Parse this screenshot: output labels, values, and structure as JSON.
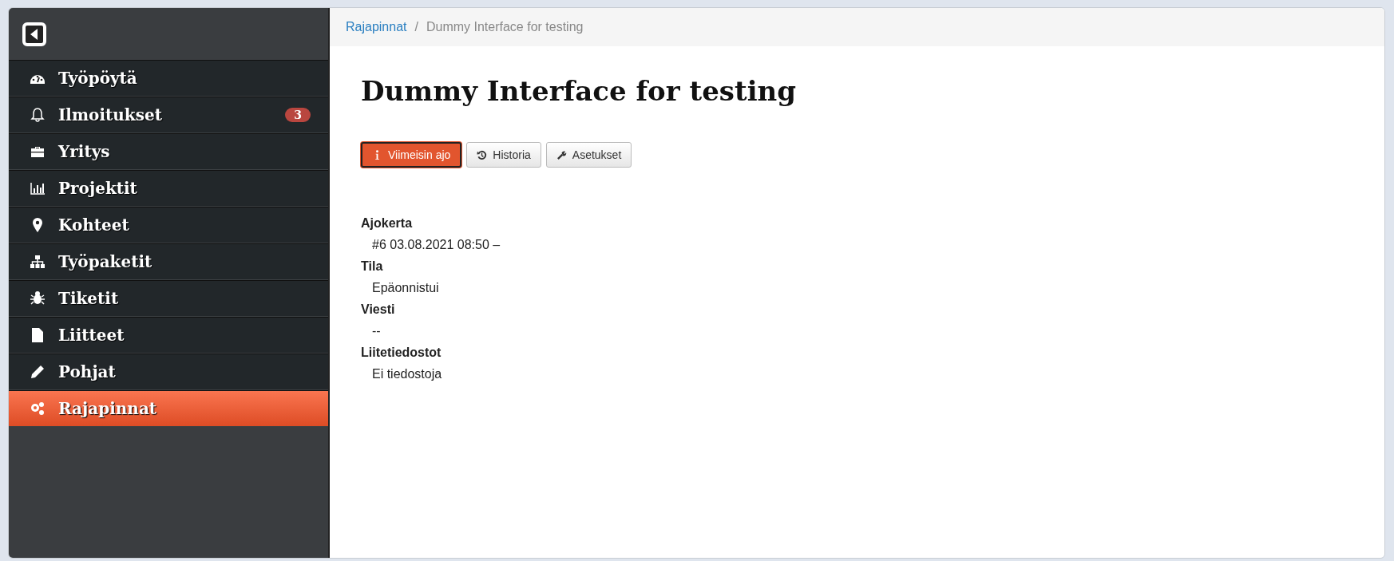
{
  "sidebar": {
    "items": [
      {
        "label": "Työpöytä",
        "selected": false
      },
      {
        "label": "Ilmoitukset",
        "selected": false,
        "badge": "3"
      },
      {
        "label": "Yritys",
        "selected": false
      },
      {
        "label": "Projektit",
        "selected": false
      },
      {
        "label": "Kohteet",
        "selected": false
      },
      {
        "label": "Työpaketit",
        "selected": false
      },
      {
        "label": "Tiketit",
        "selected": false
      },
      {
        "label": "Liitteet",
        "selected": false
      },
      {
        "label": "Pohjat",
        "selected": false
      },
      {
        "label": "Rajapinnat",
        "selected": true
      }
    ]
  },
  "breadcrumb": [
    {
      "label": "Rajapinnat",
      "link": true
    },
    {
      "separator": "/",
      "label": "Dummy Interface for testing",
      "link": false
    }
  ],
  "title": "Dummy Interface for testing",
  "tabs": [
    {
      "label": "Viimeisin ajo",
      "selected": true
    },
    {
      "label": "Historia",
      "selected": false
    },
    {
      "label": "Asetukset",
      "selected": false
    }
  ],
  "details": [
    {
      "term": "Ajokerta",
      "value": "#6 03.08.2021 08:50 –"
    },
    {
      "term": "Tila",
      "value": "Epäonnistui"
    },
    {
      "term": "Viesti",
      "value": "--"
    },
    {
      "term": "Liitetiedostot",
      "value": "Ei tiedostoja"
    }
  ]
}
